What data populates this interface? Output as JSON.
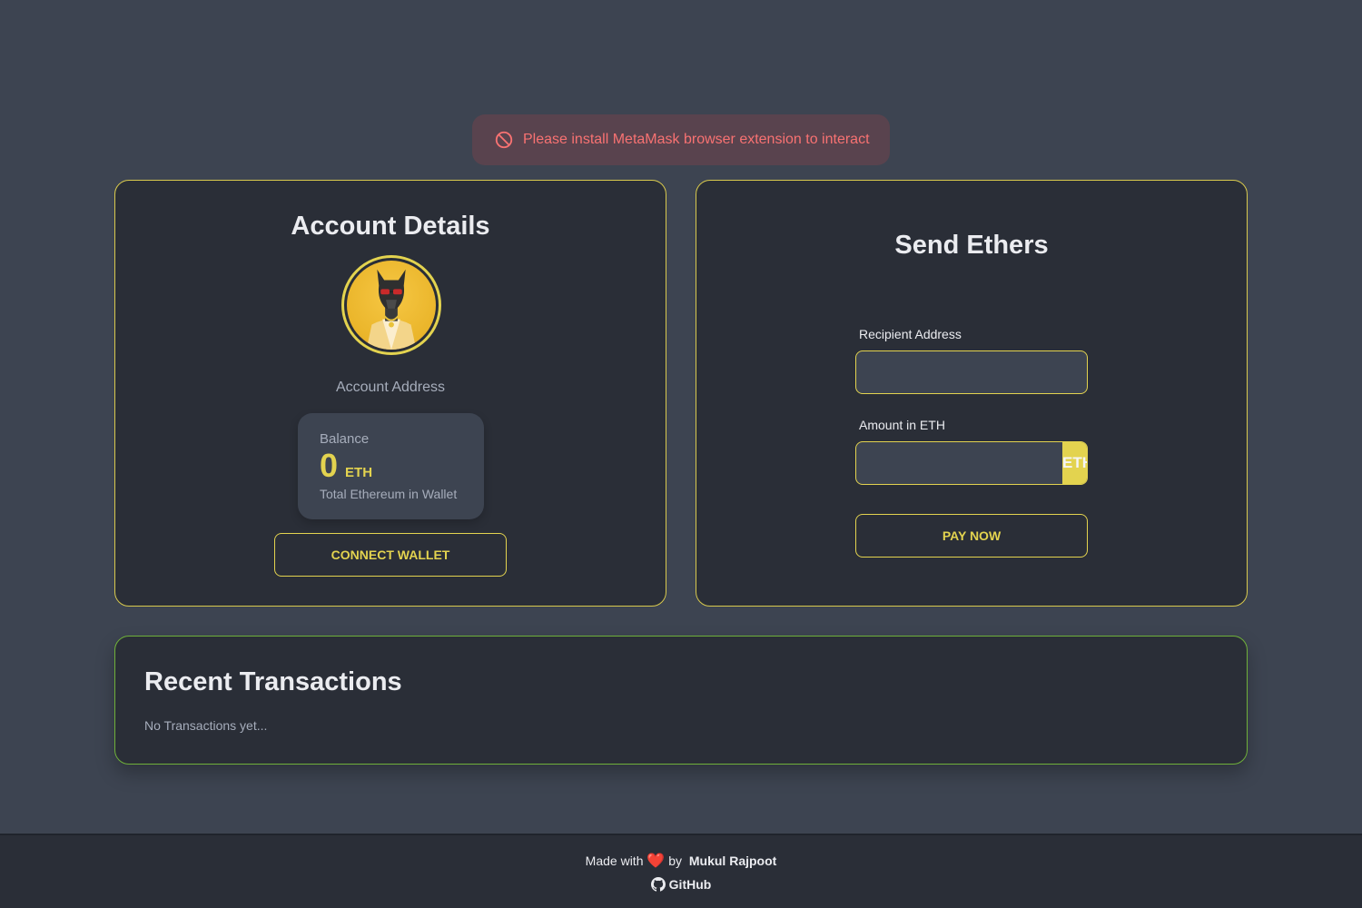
{
  "alert": {
    "icon": "no-entry-icon",
    "message": "Please install MetaMask browser extension to interact",
    "color": "#f87272"
  },
  "account": {
    "title": "Account Details",
    "address_label": "Account Address",
    "balance": {
      "title": "Balance",
      "value": "0",
      "unit": "ETH",
      "description": "Total Ethereum in Wallet"
    },
    "connect_label": "Connect Wallet"
  },
  "send": {
    "title": "Send Ethers",
    "recipient_label": "Recipient Address",
    "recipient_value": "",
    "amount_label": "Amount in ETH",
    "amount_value": "",
    "amount_addon": "ETH",
    "pay_label": "Pay Now"
  },
  "transactions": {
    "title": "Recent Transactions",
    "empty_text": "No Transactions yet..."
  },
  "footer": {
    "made_with": "Made with",
    "heart": "❤️",
    "by": "by",
    "author": "Mukul Rajpoot",
    "github_label": "GitHub"
  },
  "colors": {
    "accent": "#e3d34f",
    "background": "#3d4451",
    "card": "#2a2e37",
    "tx_border": "#6fb03a"
  }
}
